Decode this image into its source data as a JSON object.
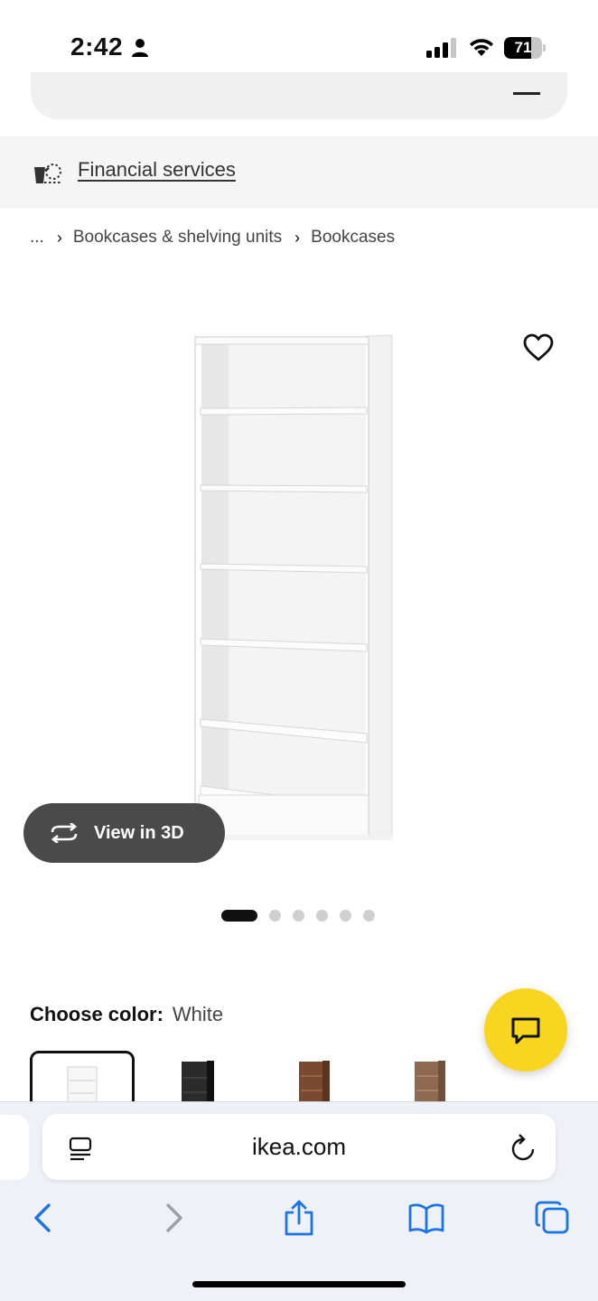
{
  "status_bar": {
    "time": "2:42",
    "battery": "71",
    "battery_fraction": 0.71
  },
  "financial_services": {
    "label": "Financial services"
  },
  "breadcrumb": {
    "ellipsis": "...",
    "items": [
      "Bookcases & shelving units",
      "Bookcases"
    ]
  },
  "product": {
    "view_3d_label": "View in 3D",
    "image_count": 6,
    "active_image": 1
  },
  "color": {
    "label": "Choose color:",
    "value": "White",
    "swatches": [
      "white",
      "black",
      "dark-brown",
      "brown"
    ]
  },
  "browser": {
    "url": "ikea.com"
  },
  "colors": {
    "chat_yellow": "#f8d51e",
    "safari_blue": "#1a73e8"
  }
}
